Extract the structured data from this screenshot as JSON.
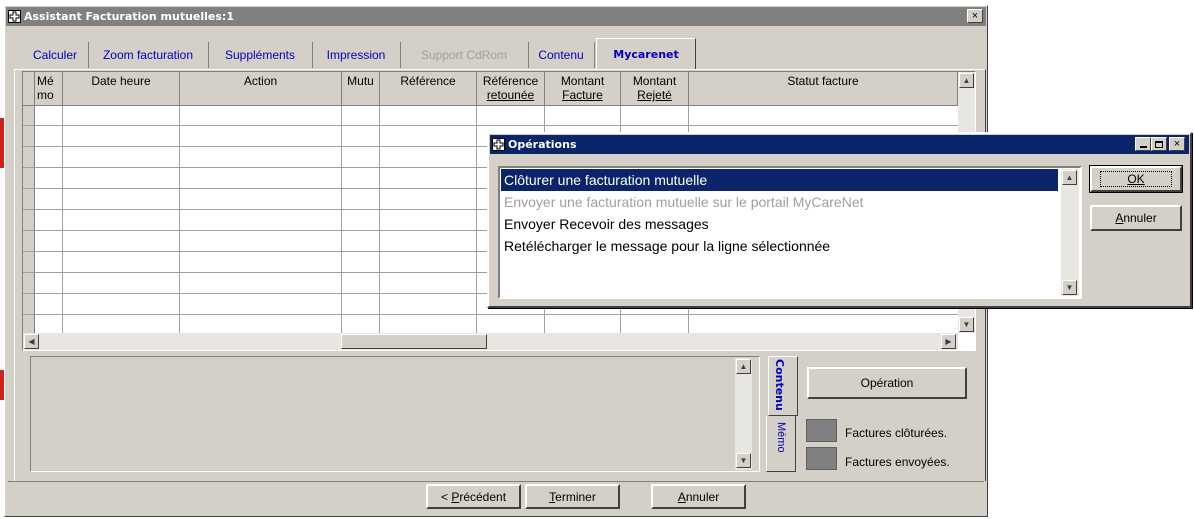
{
  "main_window": {
    "title": "Assistant Facturation mutuelles:1",
    "close_label": "×",
    "tabs": [
      {
        "label": "Calculer"
      },
      {
        "label": "Zoom facturation"
      },
      {
        "label": "Suppléments"
      },
      {
        "label": "Impression"
      },
      {
        "label": "Support CdRom"
      },
      {
        "label": "Contenu"
      },
      {
        "label": "Mycarenet"
      }
    ],
    "active_tab": "Mycarenet",
    "disabled_tab": "Support CdRom",
    "table": {
      "headers": {
        "memo_1": "Mé",
        "memo_2": "mo",
        "date": "Date heure",
        "action": "Action",
        "mutu": "Mutu",
        "reference": "Référence",
        "ref_ret_1": "Référence",
        "ref_ret_2": "retounée",
        "montant_facture_1": "Montant",
        "montant_facture_2": "Facture",
        "montant_rejete_1": "Montant",
        "montant_rejete_2": "Rejeté",
        "statut": "Statut facture"
      },
      "row_count": 11
    },
    "side_tabs": {
      "contenu": "Contenu",
      "memo": "Mémo"
    },
    "operation_button": "Opération",
    "legend": [
      {
        "label": "Factures clôturées.",
        "color": "#808080"
      },
      {
        "label": "Factures envoyées.",
        "color": "#808080"
      }
    ],
    "footer": {
      "prev": "< Précédent",
      "prev_under": "P",
      "prev_rest": "récédent",
      "prev_lead": "< ",
      "finish_under": "T",
      "finish_rest": "erminer",
      "cancel_under": "A",
      "cancel_rest": "nnuler"
    }
  },
  "dialog": {
    "title": "Opérations",
    "items": [
      {
        "label": "Clôturer une facturation mutuelle",
        "state": "selected"
      },
      {
        "label": "Envoyer une facturation mutuelle sur le portail MyCareNet",
        "state": "disabled"
      },
      {
        "label": "Envoyer Recevoir des messages",
        "state": "normal"
      },
      {
        "label": "Retélécharger le message pour la ligne sélectionnée",
        "state": "normal"
      }
    ],
    "ok_label": "OK",
    "cancel_under": "A",
    "cancel_rest": "nnuler"
  },
  "colors": {
    "titlebar": "#808080",
    "dialog_titlebar": "#0a246a",
    "selection": "#0a246a",
    "tab_text": "#0000c0",
    "face": "#d4d0c8"
  }
}
